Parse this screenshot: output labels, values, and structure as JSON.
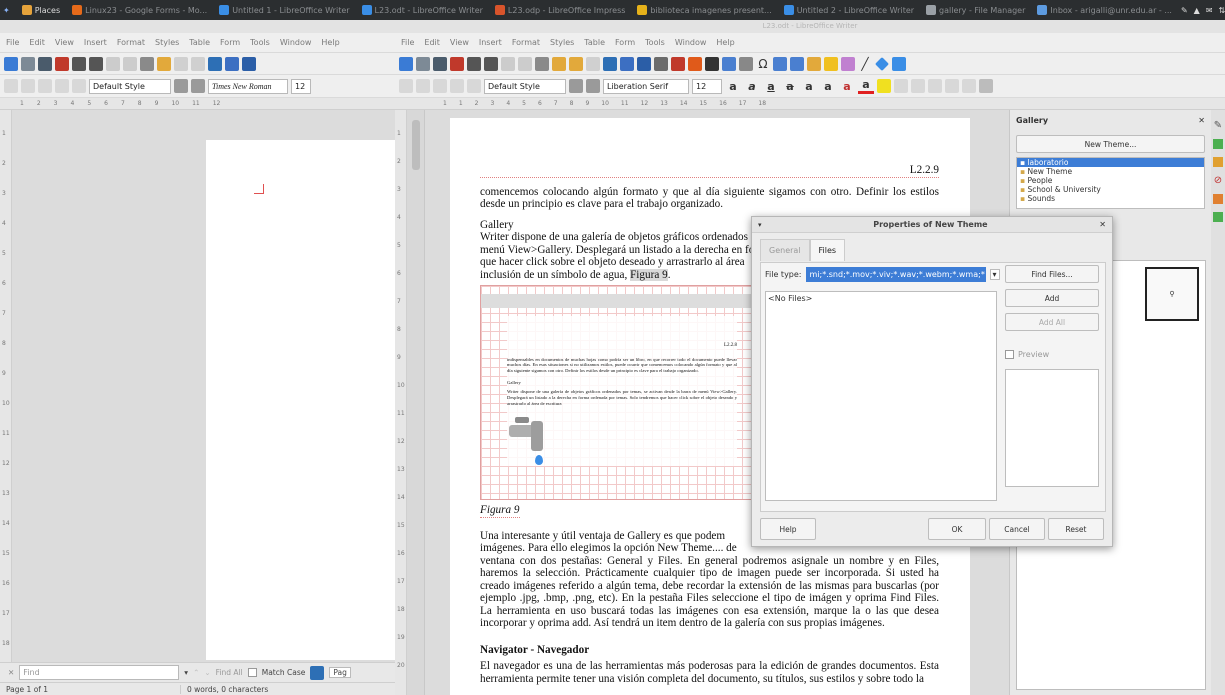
{
  "panel": {
    "items": [
      {
        "label": "Places",
        "color": "#e6a33b"
      },
      {
        "label": "Linux23 - Google Forms - Mo...",
        "color": "#e66a1a"
      },
      {
        "label": "Untitled 1 - LibreOffice Writer",
        "color": "#3a8ee6"
      },
      {
        "label": "L23.odt - LibreOffice Writer",
        "color": "#3a8ee6"
      },
      {
        "label": "L23.odp - LibreOffice Impress",
        "color": "#d9542b"
      },
      {
        "label": "biblioteca imagenes present...",
        "color": "#e6b21a"
      },
      {
        "label": "Untitled 2 - LibreOffice Writer",
        "color": "#3a8ee6"
      },
      {
        "label": "gallery - File Manager",
        "color": "#9aa0a6"
      },
      {
        "label": "Inbox - arigalli@unr.edu.ar - ...",
        "color": "#5d9be0"
      }
    ]
  },
  "left_window": {
    "menu": [
      "File",
      "Edit",
      "View",
      "Insert",
      "Format",
      "Styles",
      "Table",
      "Form",
      "Tools",
      "Window",
      "Help"
    ],
    "style": "Default Style",
    "font": "Times New Roman",
    "size": "12",
    "ruler": [
      "1",
      "2",
      "3",
      "4",
      "5",
      "6",
      "7",
      "8",
      "9",
      "10",
      "11",
      "12"
    ],
    "vruler": [
      "1",
      "2",
      "3",
      "4",
      "5",
      "6",
      "7",
      "8",
      "9",
      "10",
      "11",
      "12",
      "13",
      "14",
      "15",
      "16",
      "17",
      "18"
    ],
    "find_placeholder": "Find",
    "find_all": "Find All",
    "match_case": "Match Case",
    "pag": "Pag",
    "status_page": "Page 1 of 1",
    "status_words": "0 words, 0 characters"
  },
  "right_window": {
    "title": "L23.odt - LibreOffice Writer",
    "menu": [
      "File",
      "Edit",
      "View",
      "Insert",
      "Format",
      "Styles",
      "Table",
      "Form",
      "Tools",
      "Window",
      "Help"
    ],
    "style": "Default Style",
    "font": "Liberation Serif",
    "size": "12",
    "ruler": [
      "1",
      "1",
      "2",
      "3",
      "4",
      "5",
      "6",
      "7",
      "8",
      "9",
      "10",
      "11",
      "12",
      "13",
      "14",
      "15",
      "16",
      "17",
      "18"
    ],
    "vruler": [
      "1",
      "2",
      "3",
      "4",
      "5",
      "6",
      "7",
      "8",
      "9",
      "10",
      "11",
      "12",
      "13",
      "14",
      "15",
      "16",
      "17",
      "18",
      "19",
      "20"
    ],
    "doc": {
      "header": "L2.2.9",
      "p1": "comencemos colocando algún formato y que al día siguiente sigamos con otro. Definir los estilos desde un principio es clave para el trabajo organizado.",
      "gallery_title": "Gallery",
      "gallery_l1": "Writer dispone de una galería de objetos gráficos ordenados",
      "gallery_l2": "menú View>Gallery. Desplegará un listado a la derecha en fo",
      "gallery_l3": "que hacer click sobre el objeto deseado y arrastrarlo al área",
      "gallery_l4a": "inclusión de un símbolo de agua, ",
      "gallery_l4b": "Figura 9",
      "gallery_l4c": ".",
      "mini_header": "L2.2.8",
      "mini_p1": "indispensables en documentos de muchas hojas como podría ser un libro, en que recorrer todo el documento puede llevar muchos días. En esas situaciones si no utilizamos estilos, puede ocurrir que comencemos colocando algún formato y que al día siguiente sigamos con otro. Definir los estilos desde un principio es clave para el trabajo organizado.",
      "mini_title": "Gallery",
      "mini_p2": "Writer dispone de una galería de objetos gráficos ordenados por temas, se activan desde la barra de menú View>Gallery. Desplegará un listado a la derecha en forma ordenada por temas. Solo tendremos que hacer click sobre el objeto deseado y arrastrarlo al área de escritura",
      "caption": "Figura 9",
      "p2_l1": "Una interesante y útil ventaja de Gallery es que podem",
      "p2_l2": "imágenes. Para ello elegimos la opción New Theme.... de",
      "p2_rest": "ventana con dos pestañas: General y Files. En general podremos asignale un nombre y en Files, haremos la selección. Prácticamente cualquier tipo de imagen puede ser incorporada. Si usted ha creado imágenes referido a algún tema, debe recordar la extensión de las mismas para buscarlas (por ejemplo .jpg, .bmp, .png, etc). En la pestaña Files seleccione el tipo de imágen y oprima Find Files. La herramienta en uso buscará todas las imágenes con esa extensión, marque la o las que desea incorporar y oprima add. Así tendrá un item dentro de la galería con sus propias imágenes.",
      "nav_title": "Navigator - Navegador",
      "nav_p": "El navegador es una de las herramientas más poderosas para la edición de grandes documentos. Esta herramienta permite tener una visión completa del documento, su títulos, sus estilos y sobre todo la"
    }
  },
  "gallery": {
    "title": "Gallery",
    "new_theme": "New Theme...",
    "themes": [
      "laboratorio",
      "New Theme",
      "People",
      "School & University",
      "Sounds"
    ]
  },
  "dialog": {
    "title": "Properties of New Theme",
    "tabs": [
      "General",
      "Files"
    ],
    "file_type_label": "File type:",
    "file_type_value": "mi;*.snd;*.mov;*.viv;*.wav;*.webm;*.wma;*.wmv",
    "no_files": "<No Files>",
    "find_files": "Find Files...",
    "add": "Add",
    "add_all": "Add All",
    "preview": "Preview",
    "help": "Help",
    "ok": "OK",
    "cancel": "Cancel",
    "reset": "Reset"
  }
}
